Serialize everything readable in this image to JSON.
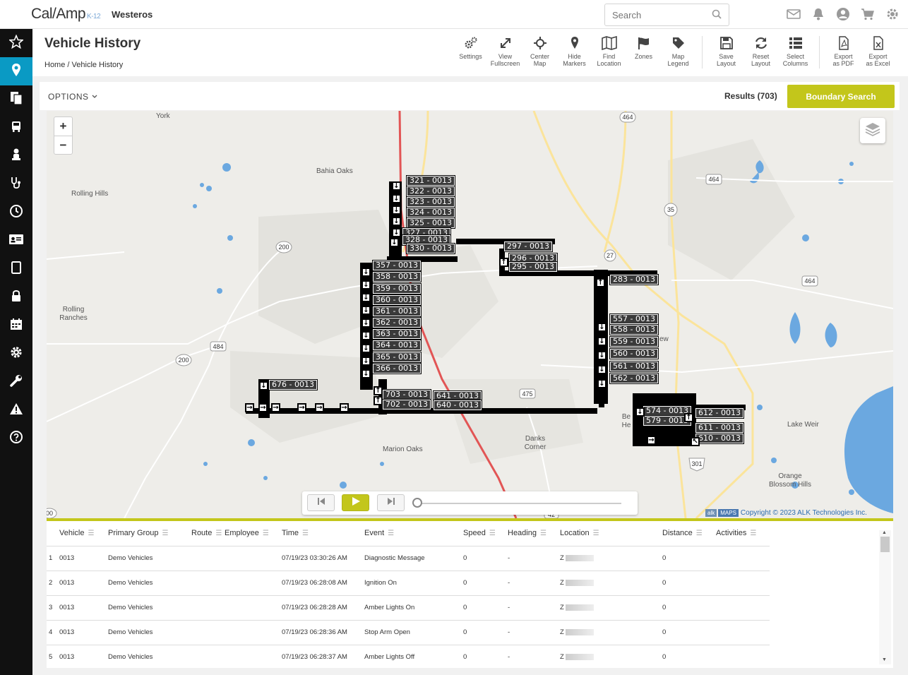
{
  "app": {
    "logo": "Cal/Amp",
    "logo_suffix": "K-12",
    "org_name": "Westeros"
  },
  "search": {
    "placeholder": "Search"
  },
  "top_icons": [
    "mail-icon",
    "bell-icon",
    "user-icon",
    "cart-icon",
    "gear-icon"
  ],
  "sidebar": {
    "items": [
      "star-icon",
      "map-pin-icon",
      "documents-icon",
      "bus-icon",
      "person-icon",
      "stethoscope-icon",
      "clock-icon",
      "id-card-icon",
      "tablet-icon",
      "lock-icon",
      "calendar-icon",
      "gear-icon",
      "wrench-icon",
      "warning-icon",
      "help-icon"
    ],
    "active_index": 1
  },
  "page": {
    "title": "Vehicle History",
    "breadcrumb_home": "Home",
    "breadcrumb_sep": "/",
    "breadcrumb_current": "Vehicle History"
  },
  "toolbar": [
    {
      "icon": "gears-icon",
      "label1": "Settings",
      "label2": ""
    },
    {
      "icon": "expand-icon",
      "label1": "View",
      "label2": "Fullscreen"
    },
    {
      "icon": "crosshair-icon",
      "label1": "Center",
      "label2": "Map"
    },
    {
      "icon": "marker-icon",
      "label1": "Hide",
      "label2": "Markers"
    },
    {
      "icon": "map-icon",
      "label1": "Find",
      "label2": "Location"
    },
    {
      "icon": "flag-icon",
      "label1": "Zones",
      "label2": ""
    },
    {
      "icon": "tag-icon",
      "label1": "Map",
      "label2": "Legend"
    },
    {
      "icon": "save-icon",
      "label1": "Save",
      "label2": "Layout"
    },
    {
      "icon": "refresh-icon",
      "label1": "Reset",
      "label2": "Layout"
    },
    {
      "icon": "list-icon",
      "label1": "Select",
      "label2": "Columns"
    },
    {
      "icon": "pdf-icon",
      "label1": "Export",
      "label2": "as PDF"
    },
    {
      "icon": "excel-icon",
      "label1": "Export",
      "label2": "as Excel"
    }
  ],
  "options": {
    "label": "OPTIONS"
  },
  "results": {
    "label": "Results (703)"
  },
  "boundary_button": {
    "label": "Boundary Search"
  },
  "map": {
    "places": [
      "York",
      "Bahia Oaks",
      "Rolling Hills",
      "Rolling Ranches",
      "Marion Oaks",
      "Danks Corner",
      "Lake Weir",
      "Orange Blossom Hills",
      "Be He",
      "ew"
    ],
    "shields": [
      "464",
      "464",
      "35",
      "27",
      "464",
      "200",
      "484",
      "200",
      "475",
      "301",
      "42",
      "00"
    ],
    "markers": [
      "321 - 0013",
      "322 - 0013",
      "323 - 0013",
      "324 - 0013",
      "325 - 0013",
      "327 - 0013",
      "328 - 0013",
      "330 - 0013",
      "357 - 0013",
      "358 - 0013",
      "359 - 0013",
      "360 - 0013",
      "361 - 0013",
      "362 - 0013",
      "363 - 0013",
      "364 - 0013",
      "365 - 0013",
      "366 - 0013",
      "296 - 0013",
      "297 - 0013",
      "295 - 0013",
      "283 - 0013",
      "557 - 0013",
      "558 - 0013",
      "559 - 0013",
      "560 - 0013",
      "561 - 0013",
      "562 - 0013",
      "676 - 0013",
      "703 - 0013",
      "702 - 0013",
      "641 - 0013",
      "640 - 0013",
      "574 - 0013",
      "579 - 0013",
      "612 - 0013",
      "611 - 0013",
      "610 - 0013"
    ],
    "copyright_alk": "alk",
    "copyright_maps": "MAPS",
    "copyright": "Copyright © 2023 ALK Technologies Inc."
  },
  "player": {
    "buttons": [
      "skip-back-icon",
      "play-icon",
      "skip-forward-icon"
    ],
    "progress": 0.0
  },
  "table": {
    "columns": [
      "Vehicle",
      "Primary Group",
      "Route",
      "Employee",
      "Time",
      "Event",
      "Speed",
      "Heading",
      "Location",
      "Distance",
      "Activities"
    ],
    "rows": [
      {
        "n": "1",
        "vehicle": "0013",
        "group": "Demo Vehicles",
        "route": "",
        "employee": "",
        "time": "07/19/23 03:30:26 AM",
        "event": "Diagnostic Message",
        "speed": "0",
        "heading": "-",
        "location": "Z",
        "distance": "0",
        "activities": ""
      },
      {
        "n": "2",
        "vehicle": "0013",
        "group": "Demo Vehicles",
        "route": "",
        "employee": "",
        "time": "07/19/23 06:28:08 AM",
        "event": "Ignition On",
        "speed": "0",
        "heading": "-",
        "location": "Z",
        "distance": "0",
        "activities": ""
      },
      {
        "n": "3",
        "vehicle": "0013",
        "group": "Demo Vehicles",
        "route": "",
        "employee": "",
        "time": "07/19/23 06:28:28 AM",
        "event": "Amber Lights On",
        "speed": "0",
        "heading": "-",
        "location": "Z",
        "distance": "0",
        "activities": ""
      },
      {
        "n": "4",
        "vehicle": "0013",
        "group": "Demo Vehicles",
        "route": "",
        "employee": "",
        "time": "07/19/23 06:28:36 AM",
        "event": "Stop Arm Open",
        "speed": "0",
        "heading": "-",
        "location": "Z",
        "distance": "0",
        "activities": ""
      },
      {
        "n": "5",
        "vehicle": "0013",
        "group": "Demo Vehicles",
        "route": "",
        "employee": "",
        "time": "07/19/23 06:28:37 AM",
        "event": "Amber Lights Off",
        "speed": "0",
        "heading": "-",
        "location": "Z",
        "distance": "0",
        "activities": ""
      }
    ]
  },
  "colors": {
    "accent": "#c3c61b",
    "active_nav": "#0a9ac4",
    "sidebar": "#111111",
    "water": "#6ba8e0",
    "route_red": "#e25555"
  }
}
